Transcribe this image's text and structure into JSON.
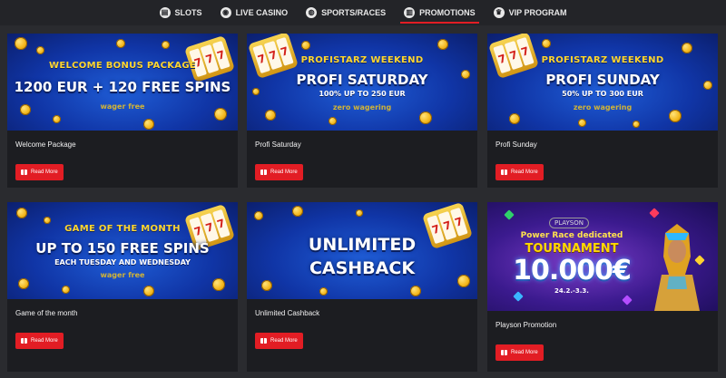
{
  "nav": {
    "items": [
      {
        "label": "SLOTS",
        "icon": "slot-icon",
        "glyph": "▤",
        "active": false
      },
      {
        "label": "LIVE CASINO",
        "icon": "chip-icon",
        "glyph": "◉",
        "active": false
      },
      {
        "label": "SPORTS/RACES",
        "icon": "vr-icon",
        "glyph": "◍",
        "active": false
      },
      {
        "label": "PROMOTIONS",
        "icon": "gift-icon",
        "glyph": "▥",
        "active": true
      },
      {
        "label": "VIP PROGRAM",
        "icon": "crown-icon",
        "glyph": "♛",
        "active": false
      }
    ],
    "accent": "#e21d24"
  },
  "button_label": "Read More",
  "promos": [
    {
      "title": "Welcome Package",
      "banner": {
        "top": "WELCOME BONUS PACKAGE",
        "main": "1200 EUR + 120 FREE SPINS",
        "sub": "",
        "wager": "wager free"
      }
    },
    {
      "title": "Profi Saturday",
      "banner": {
        "top": "PROFISTARZ WEEKEND",
        "main": "PROFI SATURDAY",
        "sub": "100% UP TO 250 EUR",
        "wager": "zero wagering"
      }
    },
    {
      "title": "Profi Sunday",
      "banner": {
        "top": "PROFISTARZ WEEKEND",
        "main": "PROFI SUNDAY",
        "sub": "50% UP TO 300 EUR",
        "wager": "zero wagering"
      }
    },
    {
      "title": "Game of the month",
      "banner": {
        "top": "GAME OF THE MONTH",
        "main": "UP TO 150 FREE SPINS",
        "sub": "EACH TUESDAY AND WEDNESDAY",
        "wager": "wager free"
      }
    },
    {
      "title": "Unlimited Cashback",
      "banner": {
        "top": "",
        "main": "UNLIMITED",
        "main2": "CASHBACK",
        "sub": "",
        "wager": ""
      }
    },
    {
      "title": "Playson Promotion",
      "banner": {
        "logo": "PLAYSON",
        "line1": "Power Race dedicated",
        "line2": "TOURNAMENT",
        "line3": "10.000€",
        "line4": "24.2.-3.3."
      }
    }
  ],
  "colors": {
    "page_bg": "#2a2b2f",
    "card_bg": "#1c1d21",
    "banner_blue": "#1f5dd6",
    "gold": "#ffd630",
    "button": "#e21d24"
  }
}
